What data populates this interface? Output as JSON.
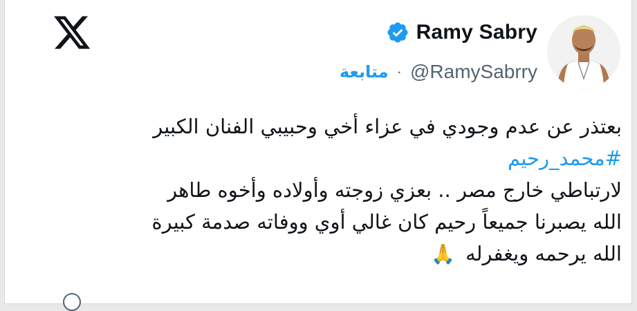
{
  "card": {
    "logo": "x-logo-icon",
    "author": {
      "display_name": "Ramy Sabry",
      "handle": "@RamySabrry",
      "separator": "·",
      "follow_label": "متابعة",
      "verified_color": "#1d9bf0"
    },
    "tweet": {
      "line1": "بعتذر عن عدم وجودي في عزاء أخي وحبيبي الفنان الكبير",
      "hashtag": "#محمد_رحيم",
      "line3": "لارتباطي خارج مصر .. بعزي زوجته وأولاده وأخوه طاهر",
      "line4": "الله يصبرنا جميعاً رحيم كان غالي أوي ووفاته صدمة كبيرة",
      "line5": "الله يرحمه ويغفرله",
      "emoji": "🙏"
    }
  },
  "colors": {
    "accent": "#1d9bf0",
    "text": "#0f1419",
    "muted": "#536471"
  }
}
